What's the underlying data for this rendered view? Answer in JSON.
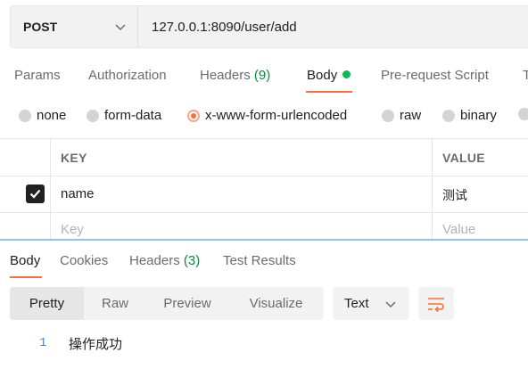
{
  "request": {
    "method": "POST",
    "url": "127.0.0.1:8090/user/add"
  },
  "request_tabs": [
    {
      "label": "Params"
    },
    {
      "label": "Authorization"
    },
    {
      "label": "Headers",
      "count": "(9)"
    },
    {
      "label": "Body",
      "indicator_color": "#0cbb52"
    },
    {
      "label": "Pre-request Script"
    },
    {
      "label": "T"
    }
  ],
  "active_request_tab": "Body",
  "body_types": [
    {
      "label": "none"
    },
    {
      "label": "form-data"
    },
    {
      "label": "x-www-form-urlencoded",
      "selected": true
    },
    {
      "label": "raw"
    },
    {
      "label": "binary"
    }
  ],
  "params_table": {
    "columns": [
      "KEY",
      "VALUE"
    ],
    "rows": [
      {
        "checked": true,
        "key": "name",
        "value": "测试"
      }
    ],
    "new_row_placeholder": {
      "key": "Key",
      "value": "Value"
    }
  },
  "response_tabs": [
    {
      "label": "Body"
    },
    {
      "label": "Cookies"
    },
    {
      "label": "Headers",
      "count": "(3)"
    },
    {
      "label": "Test Results"
    }
  ],
  "active_response_tab": "Body",
  "view_modes": [
    "Pretty",
    "Raw",
    "Preview",
    "Visualize"
  ],
  "active_view_mode": "Pretty",
  "format_select": {
    "value": "Text"
  },
  "wrap_icon": "wrap-lines-icon",
  "response_body": [
    {
      "line": "1",
      "text": "操作成功"
    }
  ],
  "colors": {
    "accent": "#ff6c37",
    "success": "#0b8a3e",
    "divider": "#8cc6ee"
  }
}
